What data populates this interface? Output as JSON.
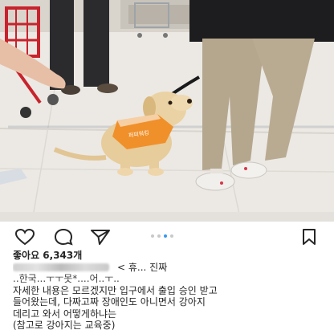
{
  "post": {
    "likes": "좋아요 6,343개",
    "caption_line1": "< 휴... 진짜",
    "caption_line2": "..한국...ㅜㅜ못*....어..ㅜ..",
    "caption_line3": "자세한 내용은 모르겠지만 입구에서 출입 승인 받고",
    "caption_line4": "들어왔는데, 다짜고짜 장애인도 아니면서 강아지",
    "caption_line5": "데리고 와서 어떻게하냐는",
    "caption_line6": "(참고로 강아지는 교육중)"
  },
  "photo": {
    "vest_text": "퍼피워킹"
  },
  "carousel": {
    "count": 4,
    "active_index": 2
  },
  "icons": [
    "heart-icon",
    "comment-icon",
    "share-icon",
    "bookmark-icon"
  ],
  "colors": {
    "accent": "#3897f0",
    "vest": "#f0902a",
    "floor": "#ece9e4"
  }
}
